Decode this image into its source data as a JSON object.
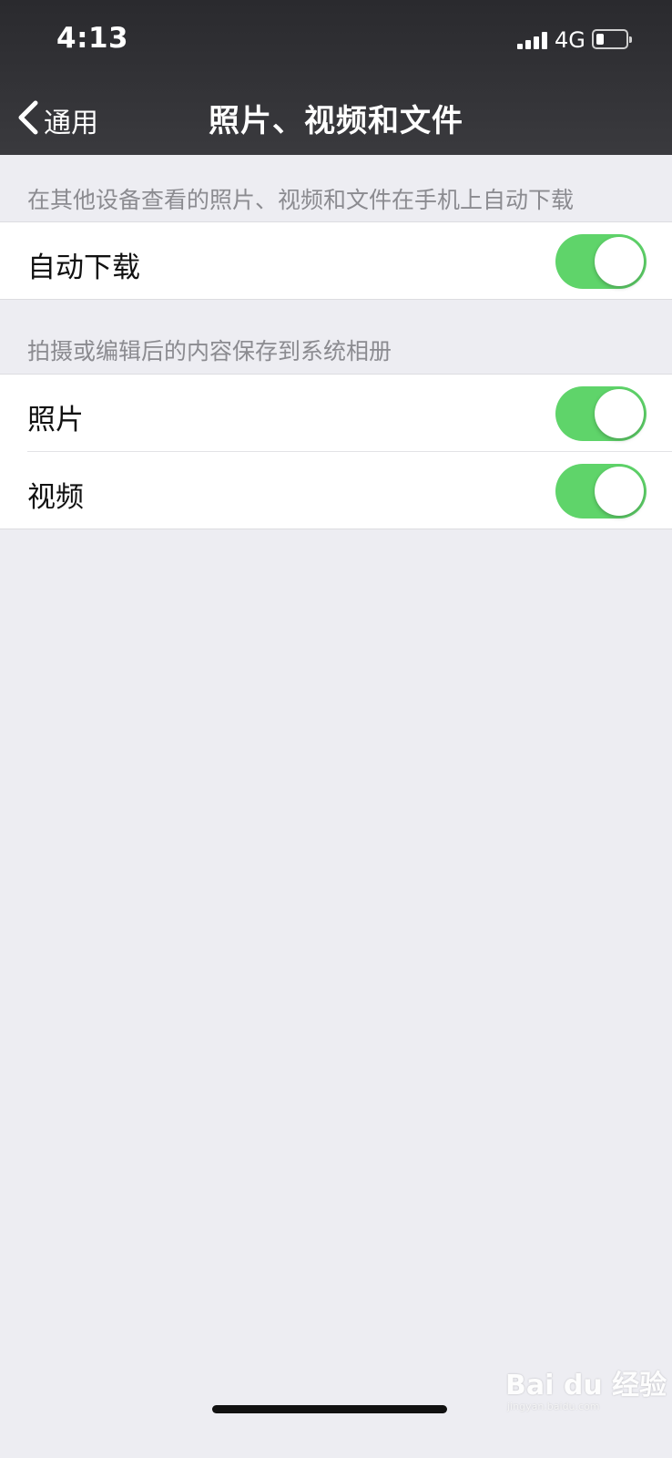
{
  "status_bar": {
    "time": "4:13",
    "network": "4G",
    "signal_bars": 4,
    "battery_level": 0.2
  },
  "nav": {
    "back_label": "通用",
    "title": "照片、视频和文件"
  },
  "sections": [
    {
      "header": "在其他设备查看的照片、视频和文件在手机上自动下载",
      "rows": [
        {
          "label": "自动下载",
          "toggle_on": true
        }
      ]
    },
    {
      "header": "拍摄或编辑后的内容保存到系统相册",
      "rows": [
        {
          "label": "照片",
          "toggle_on": true
        },
        {
          "label": "视频",
          "toggle_on": true
        }
      ]
    }
  ],
  "watermark": {
    "text": "Bai du 经验",
    "subtext": "jingyan.baidu.com"
  },
  "colors": {
    "nav_background": "#2f2f33",
    "page_background": "#ededf2",
    "toggle_on": "#5fd46a",
    "section_header_text": "#8b8b90"
  },
  "icons": {
    "back": "chevron-left-icon",
    "signal": "signal-icon",
    "battery": "battery-icon"
  }
}
